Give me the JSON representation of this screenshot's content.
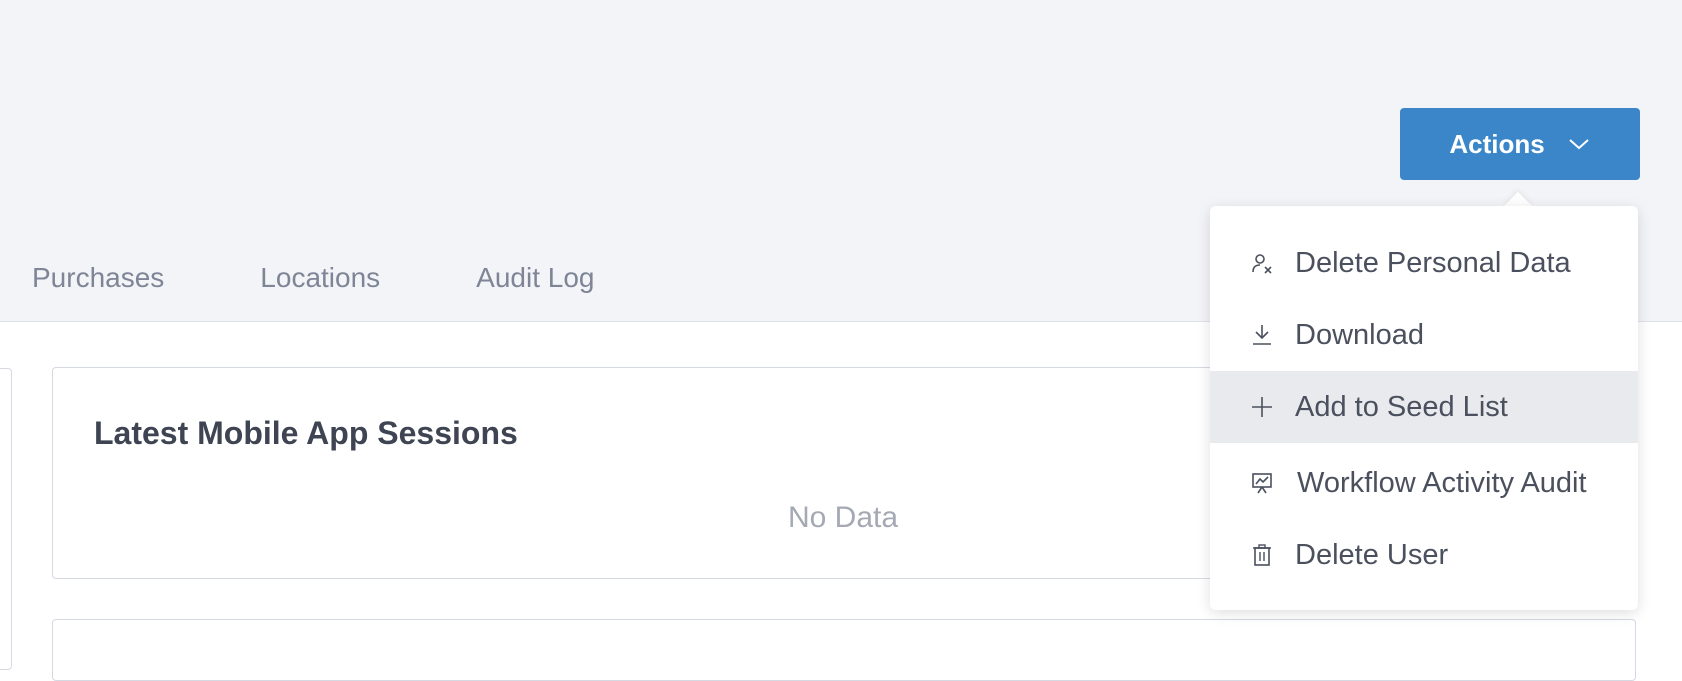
{
  "header": {
    "actions_label": "Actions"
  },
  "tabs": [
    {
      "label": "Purchases"
    },
    {
      "label": "Locations"
    },
    {
      "label": "Audit Log"
    }
  ],
  "cards": {
    "mobile_sessions": {
      "title": "Latest Mobile App Sessions",
      "empty_text": "No Data"
    }
  },
  "actions_menu": {
    "items": [
      {
        "label": "Delete Personal Data",
        "icon": "user-remove-icon"
      },
      {
        "label": "Download",
        "icon": "download-icon"
      },
      {
        "label": "Add to Seed List",
        "icon": "plus-icon",
        "highlighted": true
      },
      {
        "label": "Workflow Activity Audit",
        "icon": "presentation-chart-icon"
      },
      {
        "label": "Delete User",
        "icon": "trash-icon"
      }
    ]
  },
  "colors": {
    "accent": "#3a86c8",
    "header_bg": "#f3f4f8",
    "menu_highlight": "#e9eaed"
  }
}
